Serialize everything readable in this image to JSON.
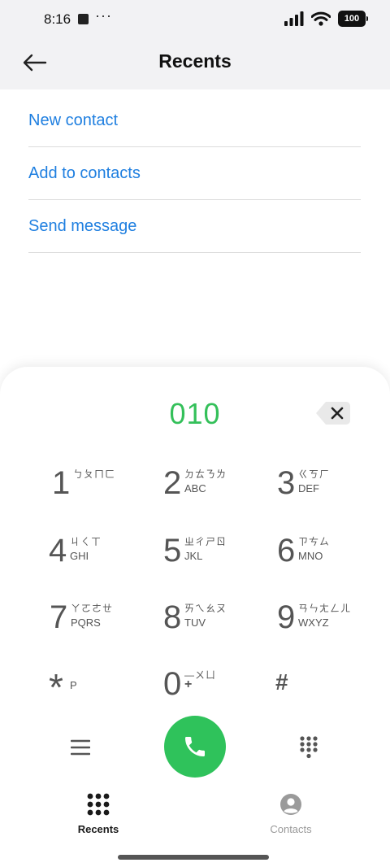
{
  "status_bar": {
    "time": "8:16",
    "dots": "···",
    "battery": "100"
  },
  "header": {
    "title": "Recents",
    "back_icon": "arrow-left-icon"
  },
  "options": [
    {
      "label": "New contact"
    },
    {
      "label": "Add to contacts"
    },
    {
      "label": "Send message"
    }
  ],
  "dialer": {
    "number": "010",
    "keys": [
      {
        "digit": "1",
        "zhuyin": "ㄅㄆㄇㄈ",
        "letters": ""
      },
      {
        "digit": "2",
        "zhuyin": "ㄉㄊㄋㄌ",
        "letters": "ABC"
      },
      {
        "digit": "3",
        "zhuyin": "ㄍㄎㄏ",
        "letters": "DEF"
      },
      {
        "digit": "4",
        "zhuyin": "ㄐㄑㄒ",
        "letters": "GHI"
      },
      {
        "digit": "5",
        "zhuyin": "ㄓㄔㄕㄖ",
        "letters": "JKL"
      },
      {
        "digit": "6",
        "zhuyin": "ㄗㄘㄙ",
        "letters": "MNO"
      },
      {
        "digit": "7",
        "zhuyin": "ㄚㄛㄜㄝ",
        "letters": "PQRS"
      },
      {
        "digit": "8",
        "zhuyin": "ㄞㄟㄠㄡ",
        "letters": "TUV"
      },
      {
        "digit": "9",
        "zhuyin": "ㄢㄣㄤㄥㄦ",
        "letters": "WXYZ"
      },
      {
        "digit": "*",
        "zhuyin": "",
        "letters": "P"
      },
      {
        "digit": "0",
        "zhuyin": "—ㄨㄩ",
        "letters": "+"
      },
      {
        "digit": "#",
        "zhuyin": "",
        "letters": ""
      }
    ]
  },
  "tabs": [
    {
      "label": "Recents",
      "active": true
    },
    {
      "label": "Contacts",
      "active": false
    }
  ],
  "colors": {
    "accent_blue": "#1f7fe0",
    "call_green": "#2fc25b",
    "number_green": "#34c05a"
  }
}
